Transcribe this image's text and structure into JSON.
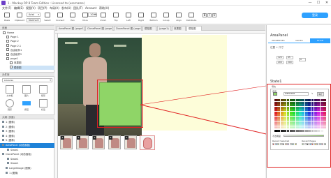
{
  "window": {
    "title": "1 - Mockup RP 8 Team Edition : Licensed to (username)",
    "min": "—",
    "max": "☐",
    "close": "✕"
  },
  "menu": [
    "文件(F)",
    "编辑(E)",
    "视图(V)",
    "项目(P)",
    "布局(A)",
    "发布(U)",
    "团队(T)",
    "Account",
    "帮助(H)"
  ],
  "toolbar": {
    "buttons": [
      "Paste",
      "Clipboard",
      "Select",
      "Connect",
      "Pen",
      "More",
      "Zoom",
      "Top",
      "Left",
      "Right",
      "Bottom",
      "Group",
      "Align",
      "Distribute"
    ],
    "font_family": "Arial",
    "font_style": "Normal",
    "zoom": "100%",
    "login_label": "登录"
  },
  "left": {
    "pages_title": "页面",
    "pages": [
      {
        "label": "Home",
        "indent": 0
      },
      {
        "label": "Page 1",
        "indent": 1
      },
      {
        "label": "Page 2",
        "indent": 1
      },
      {
        "label": "Page 2.1",
        "indent": 1
      },
      {
        "label": "自由组件1",
        "indent": 1
      },
      {
        "label": "自由组件2",
        "indent": 1
      },
      {
        "label": "page1",
        "indent": 1
      },
      {
        "label": "效果图",
        "indent": 2
      },
      {
        "label": "模型图",
        "indent": 2
      }
    ],
    "libraries_title": "元件库",
    "library_filter": "Libraries",
    "library_items": [
      "文本框",
      "图片",
      "矩形",
      "圆形",
      "按钮",
      "标签"
    ],
    "outline_title": "大纲 (页面)",
    "outline": [
      {
        "label": "1 (图像)",
        "selected": false
      },
      {
        "label": "2 (图像)",
        "selected": false
      },
      {
        "label": "3 (图像)",
        "selected": false
      },
      {
        "label": "4 (图像)",
        "selected": false
      },
      {
        "label": "5 (图像)",
        "selected": false
      },
      {
        "label": "AreaPanel (动态面板)",
        "selected": true
      },
      {
        "label": "State1",
        "selected": false
      },
      {
        "label": "ClonePanel (动态面板)",
        "selected": false
      },
      {
        "label": "State1",
        "selected": false
      },
      {
        "label": "State1",
        "selected": false
      },
      {
        "label": "LargeImage (图像)",
        "selected": false
      },
      {
        "label": "1 (图像)",
        "selected": false
      }
    ]
  },
  "canvas": {
    "tabs": [
      "AreaPanel 图 (page1)",
      "ClonePanel 图 (page1)",
      "ZoomPanel 图 (page1)",
      "模型图",
      "(page1)",
      "效果图",
      "模型图"
    ],
    "active_tab": 6,
    "thumb_indices": [
      "1",
      "2",
      "3",
      "4",
      "5"
    ]
  },
  "right": {
    "title": "AreaPanel",
    "tabs": [
      "PROPERTIES",
      "NOTES",
      "STYLE"
    ],
    "active_tab": 2,
    "position_label": "位置 + 尺寸",
    "fields": {
      "x": "120",
      "y": "85",
      "w": "200",
      "h": "200",
      "r": "0"
    },
    "state_name": "State1",
    "fill_label": "填充",
    "picker": {
      "title": "背景",
      "hex": "#8FD568",
      "ok": "确定",
      "opacity_label": "不透明度",
      "recent_label": "Recent Selected",
      "favorites_label": "Recent Pages"
    }
  },
  "colors": {
    "accent": "#2ea1ff",
    "selection_red": "#e02020",
    "fill_green": "#8fd567",
    "panel_yellow": "#fdfdd9"
  }
}
